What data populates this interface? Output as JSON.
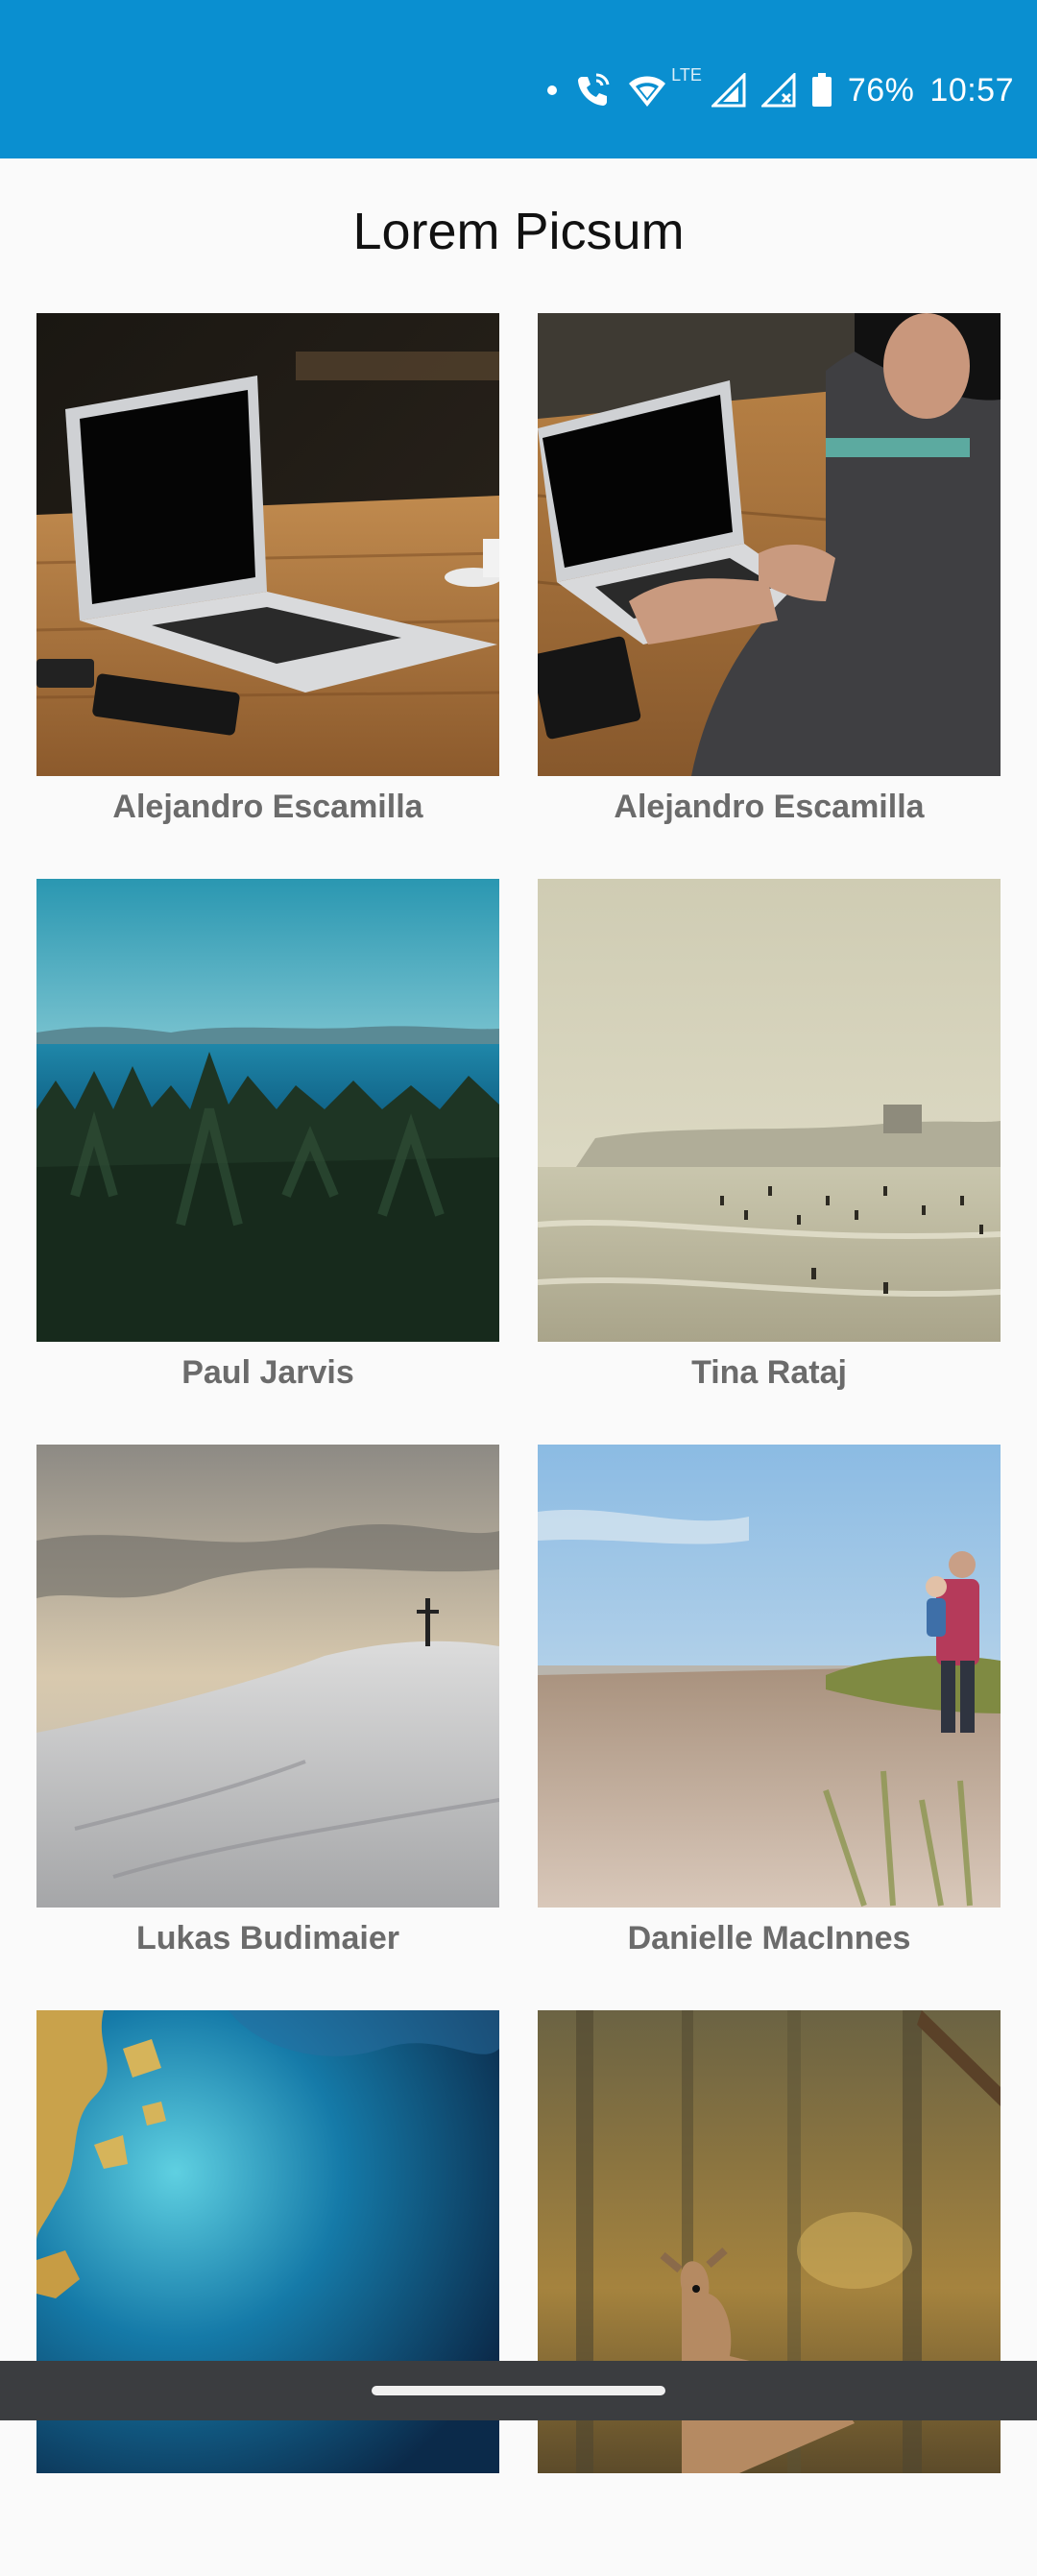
{
  "status_bar": {
    "battery_percent": "76%",
    "time": "10:57",
    "network_label": "LTE",
    "icons": [
      "notification-dot-icon",
      "wifi-call-icon",
      "wifi-icon",
      "signal-icon",
      "signal-no-data-icon",
      "battery-icon"
    ],
    "background_color": "#0a8fd0"
  },
  "app": {
    "title": "Lorem Picsum"
  },
  "gallery": {
    "items": [
      {
        "author": "Alejandro Escamilla",
        "image": "laptop on wooden desk"
      },
      {
        "author": "Alejandro Escamilla",
        "image": "man typing on laptop"
      },
      {
        "author": "Paul Jarvis",
        "image": "forest and sea"
      },
      {
        "author": "Tina Rataj",
        "image": "beach with people"
      },
      {
        "author": "Lukas Budimaier",
        "image": "snowy hill with cross"
      },
      {
        "author": "Danielle MacInnes",
        "image": "father and child on beach"
      },
      {
        "author": "",
        "image": "aerial coastline"
      },
      {
        "author": "",
        "image": "deer in forest"
      }
    ]
  }
}
